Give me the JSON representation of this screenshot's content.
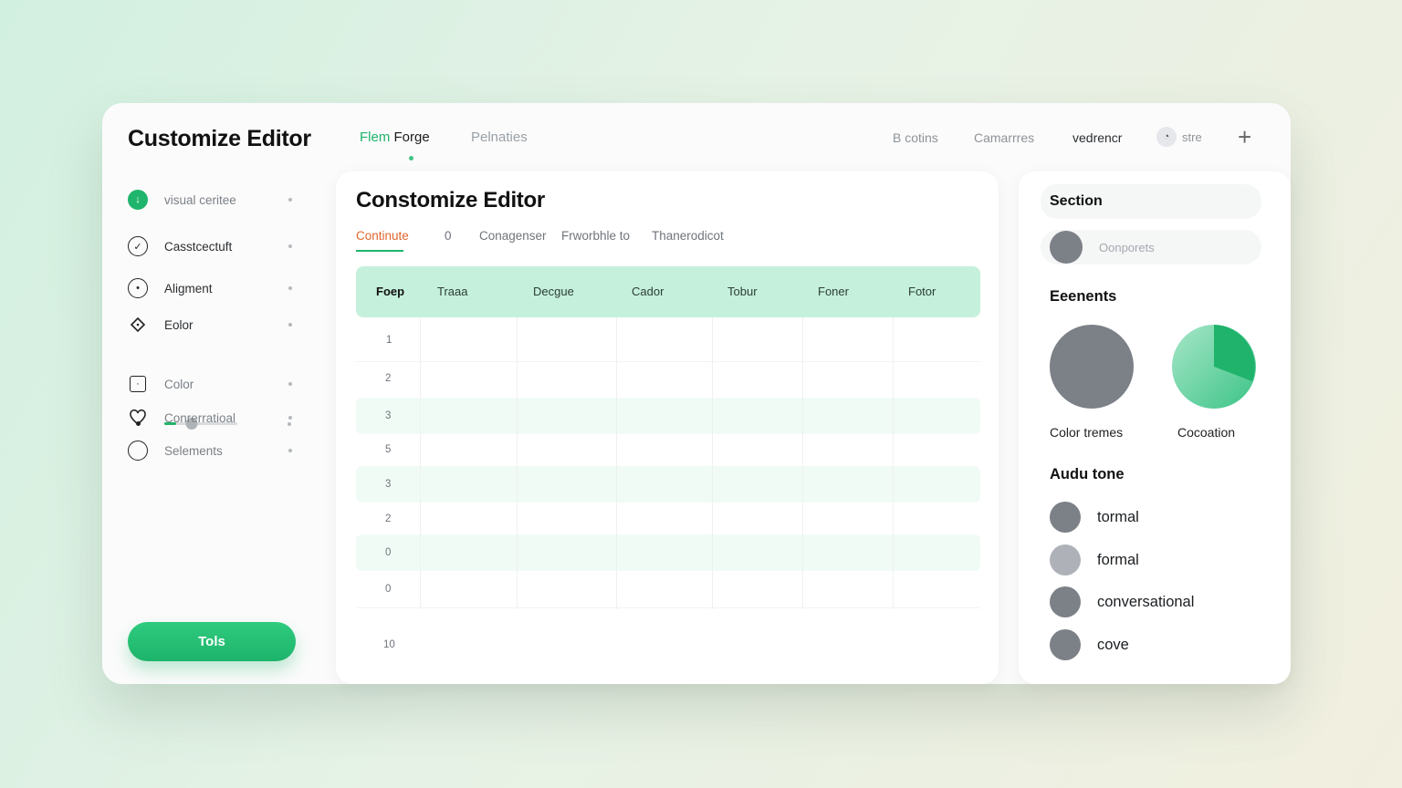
{
  "app": {
    "title": "Customize Editor"
  },
  "nav": {
    "tabs": [
      {
        "accent": "Flem",
        "label": " Forge"
      },
      {
        "label": "Pelnaties"
      }
    ],
    "links": [
      "B cotins",
      "Camarrres",
      "vedrencr"
    ],
    "user": {
      "label": "stre"
    },
    "plus": "+"
  },
  "sidebar": {
    "items": [
      {
        "label": "visual ceritee"
      },
      {
        "label": "Casstcectuft"
      },
      {
        "label": "Aligment"
      },
      {
        "label": "Eolor"
      },
      {
        "label": "Color"
      },
      {
        "label": "Conrerratioal"
      },
      {
        "label": "Selements"
      }
    ],
    "slider": {
      "value": 0.37
    },
    "button": "Tols"
  },
  "main": {
    "title": "Constomize Editor",
    "subtabs": [
      "Continute",
      "0",
      "Conagenser",
      "Frworbhle to",
      "Thanerodicot"
    ],
    "table": {
      "columns": [
        "Foep",
        "Traaa",
        "Decgue",
        "Cador",
        "Tobur",
        "Foner",
        "Fotor"
      ],
      "row_numbers": [
        "1",
        "2",
        "3",
        "5",
        "3",
        "2",
        "0",
        "0"
      ],
      "footer": "10"
    }
  },
  "right": {
    "section": "Section",
    "component": "Oonporets",
    "elements": {
      "title": "Eeenents",
      "swatches": [
        "Color tremes",
        "Cocoation"
      ]
    },
    "tone": {
      "title": "Audu tone",
      "options": [
        "tormal",
        "formal",
        "conversational",
        "cove"
      ]
    }
  },
  "colors": {
    "accent": "#20b56c",
    "header_row": "#c5f0dc",
    "avatar": "#7c8087",
    "active_subtab": "#e0662c"
  }
}
